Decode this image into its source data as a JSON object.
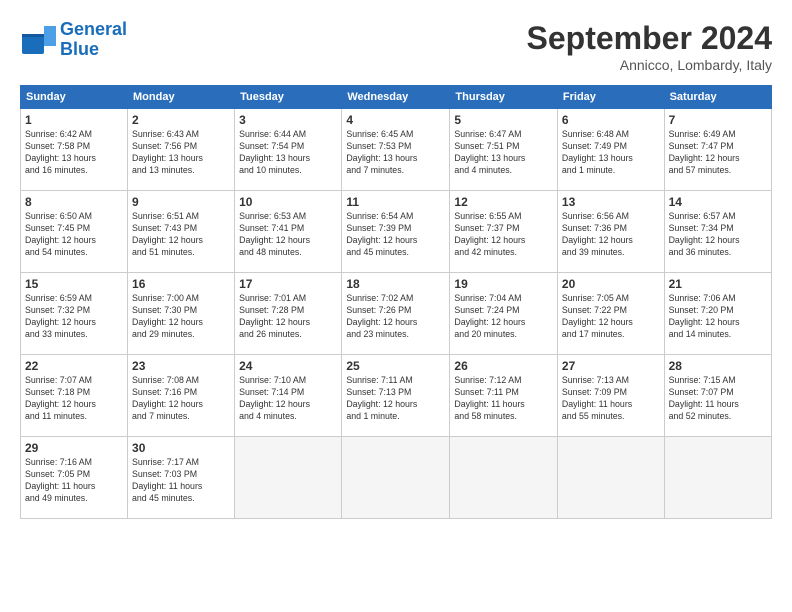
{
  "header": {
    "logo_line1": "General",
    "logo_line2": "Blue",
    "month_title": "September 2024",
    "subtitle": "Annicco, Lombardy, Italy"
  },
  "columns": [
    "Sunday",
    "Monday",
    "Tuesday",
    "Wednesday",
    "Thursday",
    "Friday",
    "Saturday"
  ],
  "weeks": [
    [
      {
        "day": "1",
        "info": "Sunrise: 6:42 AM\nSunset: 7:58 PM\nDaylight: 13 hours\nand 16 minutes."
      },
      {
        "day": "2",
        "info": "Sunrise: 6:43 AM\nSunset: 7:56 PM\nDaylight: 13 hours\nand 13 minutes."
      },
      {
        "day": "3",
        "info": "Sunrise: 6:44 AM\nSunset: 7:54 PM\nDaylight: 13 hours\nand 10 minutes."
      },
      {
        "day": "4",
        "info": "Sunrise: 6:45 AM\nSunset: 7:53 PM\nDaylight: 13 hours\nand 7 minutes."
      },
      {
        "day": "5",
        "info": "Sunrise: 6:47 AM\nSunset: 7:51 PM\nDaylight: 13 hours\nand 4 minutes."
      },
      {
        "day": "6",
        "info": "Sunrise: 6:48 AM\nSunset: 7:49 PM\nDaylight: 13 hours\nand 1 minute."
      },
      {
        "day": "7",
        "info": "Sunrise: 6:49 AM\nSunset: 7:47 PM\nDaylight: 12 hours\nand 57 minutes."
      }
    ],
    [
      {
        "day": "8",
        "info": "Sunrise: 6:50 AM\nSunset: 7:45 PM\nDaylight: 12 hours\nand 54 minutes."
      },
      {
        "day": "9",
        "info": "Sunrise: 6:51 AM\nSunset: 7:43 PM\nDaylight: 12 hours\nand 51 minutes."
      },
      {
        "day": "10",
        "info": "Sunrise: 6:53 AM\nSunset: 7:41 PM\nDaylight: 12 hours\nand 48 minutes."
      },
      {
        "day": "11",
        "info": "Sunrise: 6:54 AM\nSunset: 7:39 PM\nDaylight: 12 hours\nand 45 minutes."
      },
      {
        "day": "12",
        "info": "Sunrise: 6:55 AM\nSunset: 7:37 PM\nDaylight: 12 hours\nand 42 minutes."
      },
      {
        "day": "13",
        "info": "Sunrise: 6:56 AM\nSunset: 7:36 PM\nDaylight: 12 hours\nand 39 minutes."
      },
      {
        "day": "14",
        "info": "Sunrise: 6:57 AM\nSunset: 7:34 PM\nDaylight: 12 hours\nand 36 minutes."
      }
    ],
    [
      {
        "day": "15",
        "info": "Sunrise: 6:59 AM\nSunset: 7:32 PM\nDaylight: 12 hours\nand 33 minutes."
      },
      {
        "day": "16",
        "info": "Sunrise: 7:00 AM\nSunset: 7:30 PM\nDaylight: 12 hours\nand 29 minutes."
      },
      {
        "day": "17",
        "info": "Sunrise: 7:01 AM\nSunset: 7:28 PM\nDaylight: 12 hours\nand 26 minutes."
      },
      {
        "day": "18",
        "info": "Sunrise: 7:02 AM\nSunset: 7:26 PM\nDaylight: 12 hours\nand 23 minutes."
      },
      {
        "day": "19",
        "info": "Sunrise: 7:04 AM\nSunset: 7:24 PM\nDaylight: 12 hours\nand 20 minutes."
      },
      {
        "day": "20",
        "info": "Sunrise: 7:05 AM\nSunset: 7:22 PM\nDaylight: 12 hours\nand 17 minutes."
      },
      {
        "day": "21",
        "info": "Sunrise: 7:06 AM\nSunset: 7:20 PM\nDaylight: 12 hours\nand 14 minutes."
      }
    ],
    [
      {
        "day": "22",
        "info": "Sunrise: 7:07 AM\nSunset: 7:18 PM\nDaylight: 12 hours\nand 11 minutes."
      },
      {
        "day": "23",
        "info": "Sunrise: 7:08 AM\nSunset: 7:16 PM\nDaylight: 12 hours\nand 7 minutes."
      },
      {
        "day": "24",
        "info": "Sunrise: 7:10 AM\nSunset: 7:14 PM\nDaylight: 12 hours\nand 4 minutes."
      },
      {
        "day": "25",
        "info": "Sunrise: 7:11 AM\nSunset: 7:13 PM\nDaylight: 12 hours\nand 1 minute."
      },
      {
        "day": "26",
        "info": "Sunrise: 7:12 AM\nSunset: 7:11 PM\nDaylight: 11 hours\nand 58 minutes."
      },
      {
        "day": "27",
        "info": "Sunrise: 7:13 AM\nSunset: 7:09 PM\nDaylight: 11 hours\nand 55 minutes."
      },
      {
        "day": "28",
        "info": "Sunrise: 7:15 AM\nSunset: 7:07 PM\nDaylight: 11 hours\nand 52 minutes."
      }
    ],
    [
      {
        "day": "29",
        "info": "Sunrise: 7:16 AM\nSunset: 7:05 PM\nDaylight: 11 hours\nand 49 minutes."
      },
      {
        "day": "30",
        "info": "Sunrise: 7:17 AM\nSunset: 7:03 PM\nDaylight: 11 hours\nand 45 minutes."
      },
      null,
      null,
      null,
      null,
      null
    ]
  ]
}
